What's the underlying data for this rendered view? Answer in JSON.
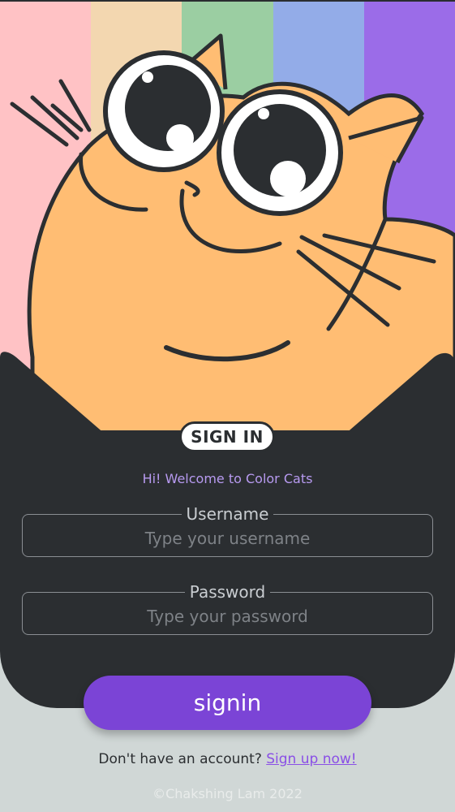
{
  "theme": {
    "stripes": [
      "#ffc2c5",
      "#f3d7b0",
      "#9bcea2",
      "#93ace8",
      "#9b6ce8"
    ],
    "cat_fur": "#ffbd73",
    "card": "#2b2e31",
    "accent": "#7b44d6"
  },
  "header": {
    "badge": "SIGN IN"
  },
  "form": {
    "welcome": "Hi! Welcome to Color Cats",
    "username": {
      "label": "Username",
      "placeholder": "Type your username",
      "value": ""
    },
    "password": {
      "label": "Password",
      "placeholder": "Type your password",
      "value": ""
    },
    "submit_label": "signin"
  },
  "footer": {
    "signup_prompt": "Don't have an account?",
    "signup_link": "Sign up now!",
    "copyright": "©Chakshing Lam 2022"
  },
  "icons": [
    "cat-illustration"
  ]
}
